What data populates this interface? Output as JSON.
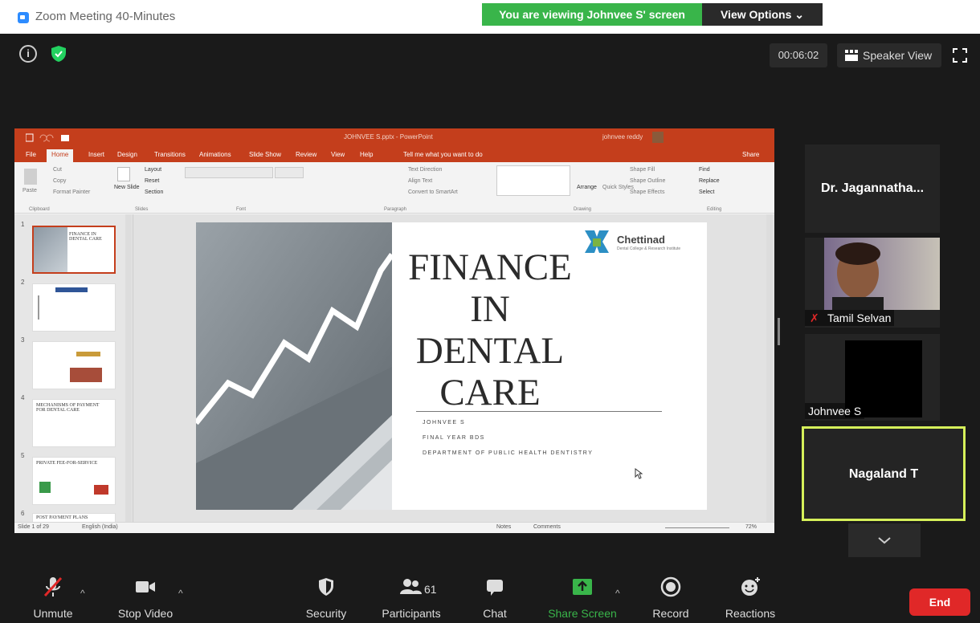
{
  "window": {
    "title": "Zoom Meeting 40-Minutes"
  },
  "banner": {
    "text": "You are viewing Johnvee S' screen",
    "view_options": "View Options ⌄"
  },
  "topbar": {
    "timer": "00:06:02",
    "speaker_view": "Speaker View",
    "info_symbol": "i"
  },
  "powerpoint": {
    "doc_title": "JOHNVEE S.pptx - PowerPoint",
    "user": "johnvee reddy",
    "tabs": [
      "File",
      "Home",
      "Insert",
      "Design",
      "Transitions",
      "Animations",
      "Slide Show",
      "Review",
      "View",
      "Help",
      "Tell me what you want to do"
    ],
    "share": "Share",
    "ribbon": {
      "cut": "Cut",
      "copy": "Copy",
      "paste": "Paste",
      "format_painter": "Format Painter",
      "new_slide": "New Slide",
      "layout": "Layout",
      "reset": "Reset",
      "section": "Section",
      "text_direction": "Text Direction",
      "align_text": "Align Text",
      "convert_smartart": "Convert to SmartArt",
      "arrange": "Arrange",
      "quick_styles": "Quick Styles",
      "shape_fill": "Shape Fill",
      "shape_outline": "Shape Outline",
      "shape_effects": "Shape Effects",
      "find": "Find",
      "replace": "Replace",
      "select": "Select",
      "groups": [
        "Clipboard",
        "Slides",
        "Font",
        "Paragraph",
        "Drawing",
        "Editing"
      ]
    },
    "thumbnails": [
      {
        "num": "1",
        "title": "FINANCE IN DENTAL CARE"
      },
      {
        "num": "2",
        "title": ""
      },
      {
        "num": "3",
        "title": ""
      },
      {
        "num": "4",
        "title": "MECHANISMS OF PAYMENT FOR DENTAL CARE"
      },
      {
        "num": "5",
        "title": "PRIVATE FEE-FOR-SERVICE"
      },
      {
        "num": "6",
        "title": "POST PAYMENT PLANS"
      }
    ],
    "slide": {
      "title_lines": [
        "FINANCE",
        "IN",
        "DENTAL",
        "CARE"
      ],
      "logo_name": "Chettinad",
      "logo_sub": "Dental College & Research Institute",
      "presenter": "JOHNVEE S",
      "year": "FINAL YEAR BDS",
      "department": "DEPARTMENT OF PUBLIC HEALTH DENTISTRY"
    },
    "status": {
      "slide_count": "Slide 1 of 29",
      "language": "English (India)",
      "notes": "Notes",
      "comments": "Comments",
      "zoom": "72%"
    }
  },
  "participants_panel": [
    {
      "name": "Dr.  Jagannatha...",
      "type": "name-only"
    },
    {
      "name": "Tamil Selvan",
      "type": "video",
      "muted": true
    },
    {
      "name": "Johnvee S",
      "type": "video-off"
    },
    {
      "name": "Nagaland T",
      "type": "active-speaker"
    }
  ],
  "toolbar": {
    "unmute": "Unmute",
    "stop_video": "Stop Video",
    "security": "Security",
    "participants": "Participants",
    "participants_count": "61",
    "chat": "Chat",
    "share_screen": "Share Screen",
    "record": "Record",
    "reactions": "Reactions",
    "end": "End"
  },
  "colors": {
    "share_green": "#39b54a",
    "end_red": "#e02828",
    "active_speaker_border": "#d6f05a",
    "powerpoint_red": "#c43e1c",
    "zoom_blue": "#2d8cff"
  }
}
